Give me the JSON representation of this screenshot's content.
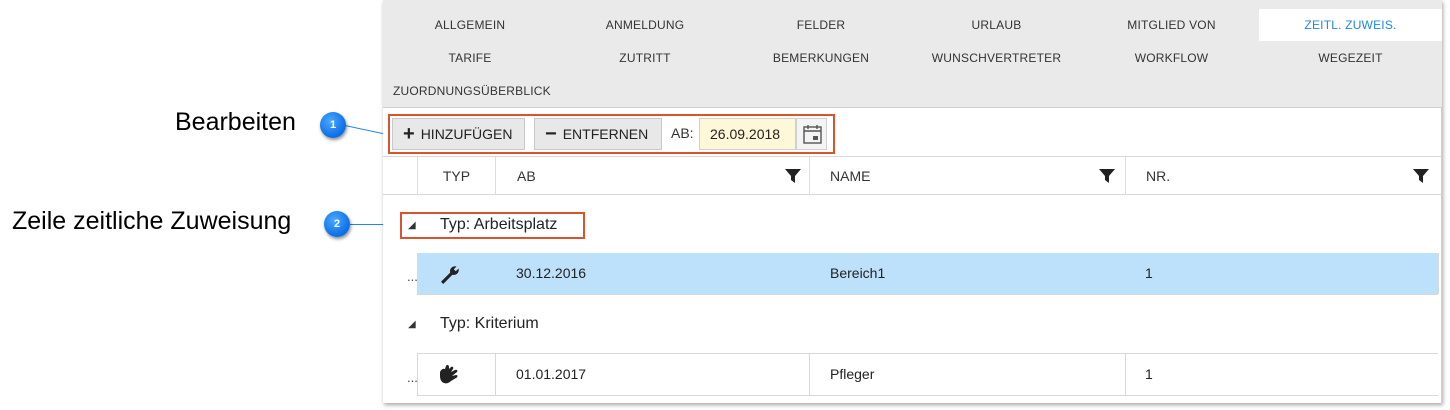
{
  "callouts": [
    {
      "number": "1",
      "label": "Bearbeiten"
    },
    {
      "number": "2",
      "label": "Zeile zeitliche Zuweisung"
    }
  ],
  "tabs": {
    "row1": [
      "ALLGEMEIN",
      "ANMELDUNG",
      "FELDER",
      "URLAUB",
      "MITGLIED VON",
      "ZEITL. ZUWEIS."
    ],
    "row2": [
      "TARIFE",
      "ZUTRITT",
      "BEMERKUNGEN",
      "WUNSCHVERTRETER",
      "WORKFLOW",
      "WEGEZEIT"
    ],
    "row3": [
      "ZUORDNUNGSÜBERBLICK"
    ],
    "active": "ZEITL. ZUWEIS."
  },
  "toolbar": {
    "add_label": "HINZUFÜGEN",
    "remove_label": "ENTFERNEN",
    "date_label": "AB:",
    "date_value": "26.09.2018"
  },
  "grid": {
    "columns": [
      "TYP",
      "AB",
      "NAME",
      "NR."
    ],
    "groups": [
      {
        "title": "Typ: Arbeitsplatz",
        "rows": [
          {
            "icon": "wrench-icon",
            "ab": "30.12.2016",
            "name": "Bereich1",
            "nr": "1",
            "selected": true
          }
        ]
      },
      {
        "title": "Typ: Kriterium",
        "rows": [
          {
            "icon": "hand-icon",
            "ab": "01.01.2017",
            "name": "Pfleger",
            "nr": "1",
            "selected": false
          }
        ]
      }
    ]
  },
  "colors": {
    "accent": "#1e88e5",
    "highlight_border": "#d9542b",
    "selected_row": "#bde0fb",
    "date_bg": "#fdf8d8"
  }
}
